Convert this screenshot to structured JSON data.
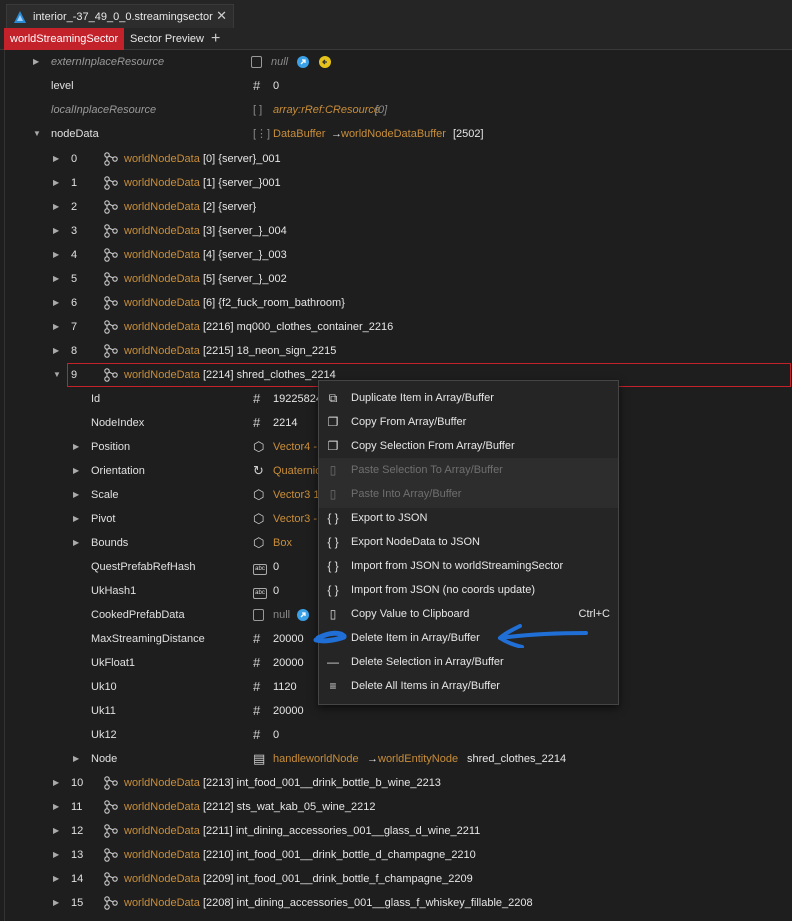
{
  "window": {
    "file_tab": "interior_-37_49_0_0.streamingsector",
    "close": "✕",
    "subtabs": [
      "worldStreamingSector",
      "Sector Preview"
    ],
    "add": "+"
  },
  "tree": {
    "top_rows": [
      {
        "name": "externInplaceResource",
        "value": "null"
      },
      {
        "name": "level",
        "value": "0"
      },
      {
        "name": "localInplaceResource",
        "value_type": "array:rRef:CResource",
        "value_count": "[0]"
      },
      {
        "name": "nodeData",
        "value_type": "DataBuffer",
        "arrow": "→",
        "value_class": "worldNodeDataBuffer",
        "value_count": "[2502]"
      }
    ],
    "node_items": [
      {
        "index": "0",
        "type": "worldNodeData",
        "label": "[0] {server}_001"
      },
      {
        "index": "1",
        "type": "worldNodeData",
        "label": "[1] {server_}001"
      },
      {
        "index": "2",
        "type": "worldNodeData",
        "label": "[2] {server}"
      },
      {
        "index": "3",
        "type": "worldNodeData",
        "label": "[3] {server_}_004"
      },
      {
        "index": "4",
        "type": "worldNodeData",
        "label": "[4] {server_}_003"
      },
      {
        "index": "5",
        "type": "worldNodeData",
        "label": "[5] {server_}_002"
      },
      {
        "index": "6",
        "type": "worldNodeData",
        "label": "[6] {f2_fuck_room_bathroom}"
      },
      {
        "index": "7",
        "type": "worldNodeData",
        "label": "[2216] mq000_clothes_container_2216"
      },
      {
        "index": "8",
        "type": "worldNodeData",
        "label": "[2215] 18_neon_sign_2215"
      },
      {
        "index": "9",
        "type": "worldNodeData",
        "label": "[2214] shred_clothes_2214"
      }
    ],
    "fields": [
      {
        "name": "Id",
        "icon": "hash",
        "value": "19225824",
        "vclass": "white"
      },
      {
        "name": "NodeIndex",
        "icon": "hash",
        "value": "2214",
        "vclass": "white"
      },
      {
        "name": "Position",
        "icon": "box",
        "value": "Vector4 -",
        "vclass": "orange"
      },
      {
        "name": "Orientation",
        "icon": "rotate",
        "value": "Quaternio",
        "vclass": "orange"
      },
      {
        "name": "Scale",
        "icon": "box",
        "value": "Vector3 1",
        "vclass": "orange"
      },
      {
        "name": "Pivot",
        "icon": "box",
        "value": "Vector3 -",
        "vclass": "orange"
      },
      {
        "name": "Bounds",
        "icon": "box",
        "value": "Box",
        "vclass": "orange"
      },
      {
        "name": "QuestPrefabRefHash",
        "icon": "abc",
        "value": "0",
        "vclass": "white"
      },
      {
        "name": "UkHash1",
        "icon": "abc",
        "value": "0",
        "vclass": "white"
      },
      {
        "name": "CookedPrefabData",
        "icon": "file",
        "value": "null",
        "vclass": "dim"
      },
      {
        "name": "MaxStreamingDistance",
        "icon": "hash",
        "value": "20000",
        "vclass": "white"
      },
      {
        "name": "UkFloat1",
        "icon": "hash",
        "value": "20000",
        "vclass": "white"
      },
      {
        "name": "Uk10",
        "icon": "hash",
        "value": "1120",
        "vclass": "white"
      },
      {
        "name": "Uk11",
        "icon": "hash",
        "value": "20000",
        "vclass": "white"
      },
      {
        "name": "Uk12",
        "icon": "hash",
        "value": "0",
        "vclass": "white"
      }
    ],
    "node_field": {
      "name": "Node",
      "handle": "handleworldNode",
      "arrow": "→",
      "cls": "worldEntityNode",
      "label": "shred_clothes_2214"
    },
    "more_items": [
      {
        "index": "10",
        "type": "worldNodeData",
        "label": "[2213] int_food_001__drink_bottle_b_wine_2213"
      },
      {
        "index": "11",
        "type": "worldNodeData",
        "label": "[2212] sts_wat_kab_05_wine_2212"
      },
      {
        "index": "12",
        "type": "worldNodeData",
        "label": "[2211] int_dining_accessories_001__glass_d_wine_2211"
      },
      {
        "index": "13",
        "type": "worldNodeData",
        "label": "[2210] int_food_001__drink_bottle_d_champagne_2210"
      },
      {
        "index": "14",
        "type": "worldNodeData",
        "label": "[2209] int_food_001__drink_bottle_f_champagne_2209"
      },
      {
        "index": "15",
        "type": "worldNodeData",
        "label": "[2208] int_dining_accessories_001__glass_f_whiskey_fillable_2208"
      }
    ]
  },
  "context_menu": {
    "items": [
      {
        "icon": "⧉",
        "label": "Duplicate Item in Array/Buffer",
        "enabled": true
      },
      {
        "icon": "❐",
        "label": "Copy From Array/Buffer",
        "enabled": true
      },
      {
        "icon": "❐",
        "label": "Copy Selection From Array/Buffer",
        "enabled": true
      },
      {
        "icon": "▯",
        "label": "Paste Selection To Array/Buffer",
        "enabled": false
      },
      {
        "icon": "▯",
        "label": "Paste Into Array/Buffer",
        "enabled": false
      },
      {
        "icon": "{ }",
        "label": "Export to JSON",
        "enabled": true
      },
      {
        "icon": "{ }",
        "label": "Export NodeData to JSON",
        "enabled": true
      },
      {
        "icon": "{ }",
        "label": "Import from JSON to worldStreamingSector",
        "enabled": true
      },
      {
        "icon": "{ }",
        "label": "Import from JSON (no coords update)",
        "enabled": true
      },
      {
        "icon": "▯",
        "label": "Copy Value to Clipboard",
        "shortcut": "Ctrl+C",
        "enabled": true
      },
      {
        "icon": "—",
        "label": "Delete Item in Array/Buffer",
        "enabled": true
      },
      {
        "icon": "—",
        "label": "Delete Selection in Array/Buffer",
        "enabled": true
      },
      {
        "icon": "≡",
        "label": "Delete All Items in Array/Buffer",
        "enabled": true
      }
    ]
  },
  "colors": {
    "accent_red": "#c4222b",
    "type_orange": "#c98e3a",
    "annotation_blue": "#1f6fd6"
  }
}
